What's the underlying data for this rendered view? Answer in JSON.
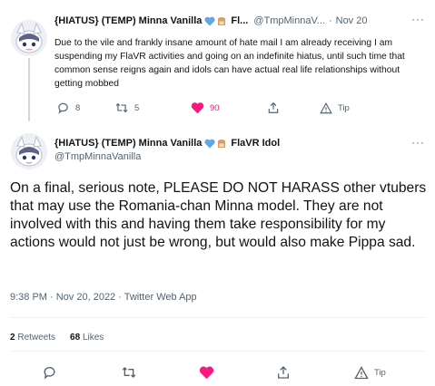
{
  "reply_tweet": {
    "author": "{HIATUS} (TEMP) Minna Vanilla",
    "author_truncation": "Fl...",
    "handle": "@TmpMinnaV...",
    "separator": "·",
    "date": "Nov 20",
    "text": "Due to the vile and frankly insane amount of hate mail I am already receiving I am suspending my FlaVR activities and going on an indefinite hiatus, until such time that common sense reigns again and idols can have actual real life relationships without getting mobbed",
    "counts": {
      "replies": "8",
      "retweets": "5",
      "likes": "90"
    },
    "tip_label": "Tip"
  },
  "main_tweet": {
    "author": "{HIATUS} (TEMP) Minna Vanilla",
    "author_suffix": "FlaVR Idol",
    "handle": "@TmpMinnaVanilla",
    "text": "On a final, serious note, PLEASE DO NOT HARASS other vtubers that may use the Romania-chan Minna model. They are not involved with this and having them take responsibility for my actions would not just be wrong, but would also make Pippa sad.",
    "timestamp": "9:38 PM · Nov 20, 2022 · Twitter Web App",
    "retweets_count": "2",
    "retweets_label": "Retweets",
    "likes_count": "68",
    "likes_label": "Likes",
    "tip_label": "Tip"
  },
  "colors": {
    "like": "#f91880",
    "muted": "#536471",
    "badge_heart": "#5ea8e8",
    "badge_bread": "#d9a066"
  },
  "icons": [
    "more-icon",
    "reply-icon",
    "retweet-icon",
    "heart-icon",
    "share-icon",
    "tip-icon",
    "blue-heart-badge-icon",
    "bread-badge-icon"
  ]
}
